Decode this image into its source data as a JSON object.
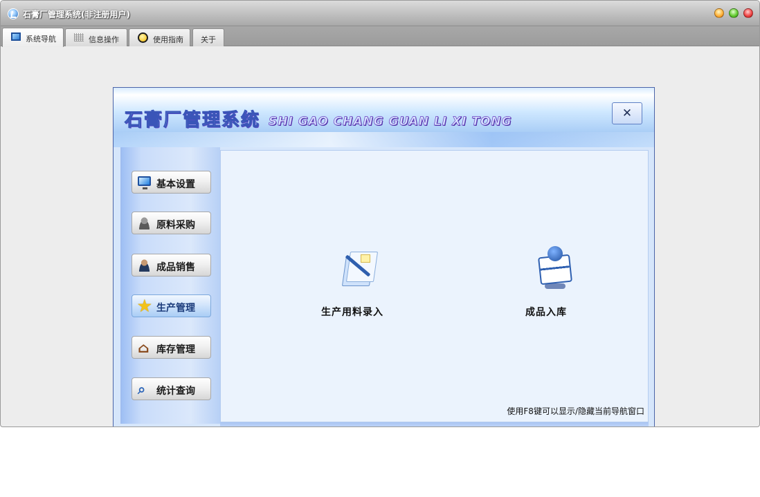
{
  "window": {
    "title": "石膏厂管理系统(非注册用户)"
  },
  "tabs": [
    {
      "label": "系统导航",
      "icon": "monitor-icon",
      "active": true
    },
    {
      "label": "信息操作",
      "icon": "grid-icon",
      "active": false
    },
    {
      "label": "使用指南",
      "icon": "guide-icon",
      "active": false
    },
    {
      "label": "关于",
      "active": false
    }
  ],
  "nav_window": {
    "title_cn": "石膏厂管理系统",
    "title_en": "SHI GAO CHANG GUAN LI XI TONG",
    "close_label": "✕"
  },
  "sidebar": {
    "items": [
      {
        "label": "基本设置",
        "icon": "monitor-icon",
        "active": false
      },
      {
        "label": "原料采购",
        "icon": "user-icon",
        "active": false
      },
      {
        "label": "成品销售",
        "icon": "salesperson-icon",
        "active": false
      },
      {
        "label": "生产管理",
        "icon": "star-icon",
        "active": true
      },
      {
        "label": "库存管理",
        "icon": "house-icon",
        "active": false
      },
      {
        "label": "统计查询",
        "icon": "magnifier-icon",
        "active": false
      }
    ]
  },
  "content": {
    "items": [
      {
        "label": "生产用料录入",
        "icon": "document-pen-icon"
      },
      {
        "label": "成品入库",
        "icon": "box-character-icon"
      }
    ],
    "hint": "使用F8键可以显示/隐藏当前导航窗口"
  },
  "colors": {
    "accent": "#3a55b8",
    "sidebar_active": "#a9cdf5"
  }
}
